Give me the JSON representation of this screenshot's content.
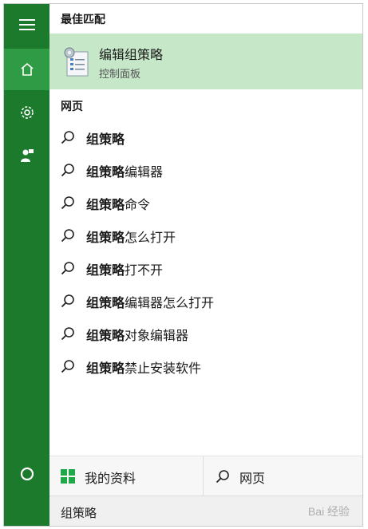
{
  "best_match": {
    "header": "最佳匹配",
    "title": "编辑组策略",
    "subtitle": "控制面板",
    "icon": "group-policy-editor-icon"
  },
  "web": {
    "header": "网页",
    "suggestions": [
      {
        "bold": "组策略",
        "rest": ""
      },
      {
        "bold": "组策略",
        "rest": "编辑器"
      },
      {
        "bold": "组策略",
        "rest": "命令"
      },
      {
        "bold": "组策略",
        "rest": "怎么打开"
      },
      {
        "bold": "组策略",
        "rest": "打不开"
      },
      {
        "bold": "组策略",
        "rest": "编辑器怎么打开"
      },
      {
        "bold": "组策略",
        "rest": "对象编辑器"
      },
      {
        "bold": "组策略",
        "rest": "禁止安装软件"
      }
    ]
  },
  "rail": {
    "items": [
      "menu-icon",
      "home-icon",
      "settings-icon",
      "feedback-icon",
      "cortana-icon"
    ]
  },
  "bottom_tabs": {
    "my_stuff": "我的资料",
    "web": "网页"
  },
  "search": {
    "value": "组策略"
  },
  "watermark": "Bai 经验",
  "colors": {
    "rail": "#1b7a2c",
    "rail_active": "#2f9b44",
    "best_match_bg": "#c6e8c9"
  }
}
